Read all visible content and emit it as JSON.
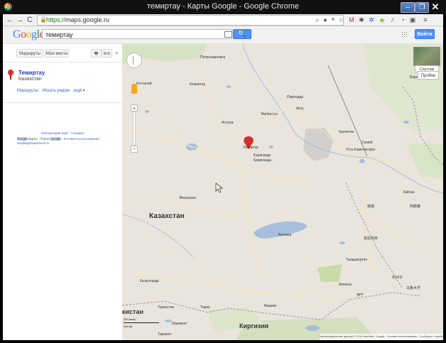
{
  "window": {
    "title": "темиртау - Карты Google - Google Chrome",
    "min_label": "–",
    "max_label": "❐",
    "close_label": "✕"
  },
  "toolbar": {
    "back": "←",
    "forward": "→",
    "reload": "C",
    "url_scheme": "https://",
    "url_host": "maps.google.ru",
    "extension_icons": [
      "search-icon",
      "location-icon",
      "translate-icon",
      "star-icon",
      "gmail-icon",
      "puzzle-icon",
      "extension-icon",
      "android-icon",
      "pen-icon",
      "clock-icon",
      "tab-icon",
      "menu-icon"
    ]
  },
  "header": {
    "logo_letters": [
      "G",
      "o",
      "o",
      "g",
      "l",
      "e"
    ],
    "logo_colors": [
      "#4285f4",
      "#db4437",
      "#f4b400",
      "#4285f4",
      "#0f9d58",
      "#db4437"
    ],
    "search_value": "темиртау",
    "search_button": "🔍",
    "signin_label": "Войти"
  },
  "sidebar": {
    "routes_label": "Маршруты",
    "myplaces_label": "Мои места",
    "print_label": "🖶",
    "link_label": "⊖⊖",
    "collapse_label": "«",
    "result": {
      "title": "Темиртау",
      "subtitle": "Казахстан",
      "actions": [
        "Маршруты",
        "Искать рядом",
        "ещё ▾"
      ]
    },
    "footer": {
      "line1": "Лаборатория Карт - Справка",
      "google": "Google",
      "maps_word": "Карты",
      "copyright": "- ©2014 ",
      "terms": "- Условия использования - Конфиденциальность"
    }
  },
  "map": {
    "labels": {
      "kazakhstan": "Казахстан",
      "kyrgyzstan": "Киргизия",
      "kyrgyz_partial": "кистан",
      "temirtau": "Темиртау",
      "karaganda": "Караганда",
      "karaganda2": "Қарағанды",
      "astana": "Астана",
      "pavlodar": "Павлодар",
      "semey": "Семей",
      "ust_kamenogorsk": "Усть-Каменогорск",
      "barnaul": "Барнаул",
      "kostanay": "Костанай",
      "zheleznodorozh": "Балхаш",
      "taldykorgan": "Талдыкорган",
      "almaty": "Алматы",
      "shymkent": "Шымкент",
      "taraz": "Тараз",
      "bishkek": "Бишкек",
      "tashkent": "Ташкент",
      "kyzylorda": "Кызылорда",
      "turkestan": "Туркестан",
      "zhezkazgan": "Жезказган",
      "urumqi": "乌鲁木齐",
      "karamay": "克拉玛依",
      "kokshetau": "Кокшетау",
      "petropavlovsk": "Петропавловск",
      "ekibastuz": "Экибастуз",
      "aksu": "Аксу",
      "kurchatov": "Курчатов",
      "zaysan": "Зайсан",
      "tacheng": "塔城",
      "yining": "伊宁",
      "shihezi": "石河子",
      "altay": "阿勒泰"
    },
    "satellite_label": "Спутник",
    "traffic_label": "Пробки",
    "copyright": "Картографические данные © 2014 AutoNavi, Google - Условия использования - Сообщить о проблеме",
    "scale_top": "200 миль",
    "scale_bottom": "500 км",
    "zoom_plus": "+",
    "zoom_minus": "−"
  }
}
